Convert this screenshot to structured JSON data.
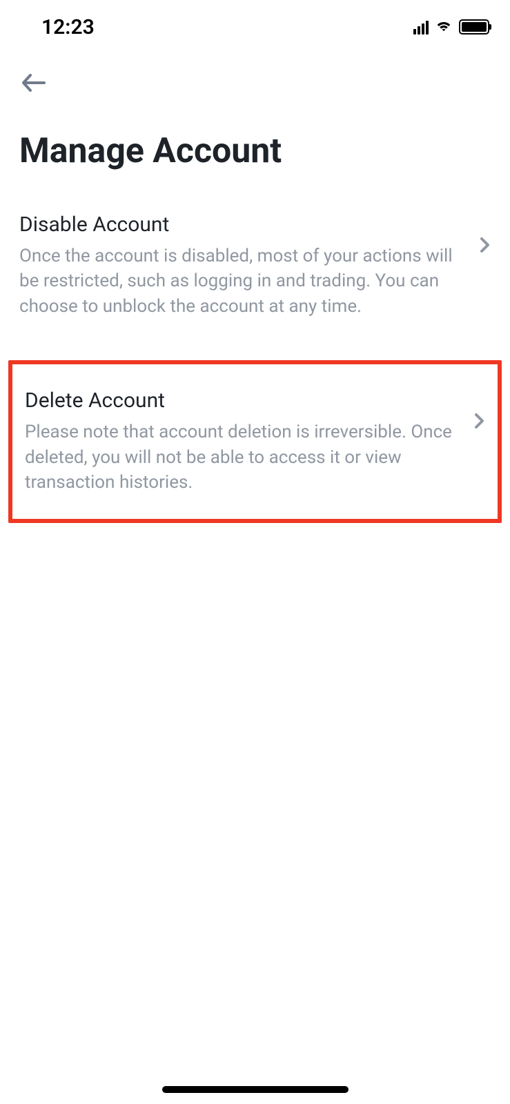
{
  "status": {
    "time": "12:23"
  },
  "page": {
    "title": "Manage Account"
  },
  "options": [
    {
      "title": "Disable Account",
      "description": "Once the account is disabled, most of your actions will be restricted, such as logging in and trading. You can choose to unblock the account at any time."
    },
    {
      "title": "Delete Account",
      "description": "Please note that account deletion is irreversible. Once deleted, you will not be able to access it or view transaction histories."
    }
  ]
}
